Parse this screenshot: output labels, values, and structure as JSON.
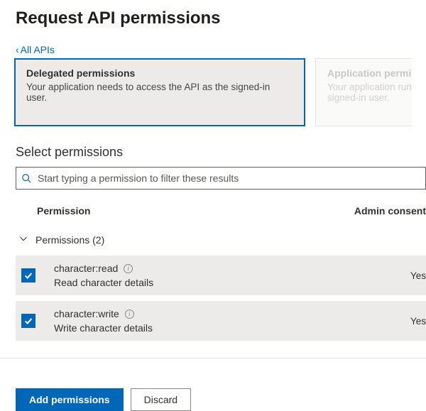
{
  "header": {
    "title": "Request API permissions"
  },
  "nav": {
    "back_label": "All APIs"
  },
  "permission_type_cards": {
    "delegated": {
      "title": "Delegated permissions",
      "subtitle": "Your application needs to access the API as the signed-in user."
    },
    "application": {
      "title": "Application permissions",
      "subtitle": "Your application runs as a background service without a signed-in user."
    }
  },
  "select_section": {
    "heading": "Select permissions",
    "search_placeholder": "Start typing a permission to filter these results"
  },
  "table": {
    "columns": {
      "permission": "Permission",
      "admin_consent": "Admin consent"
    },
    "group": {
      "label": "Permissions (2)",
      "expanded": true
    },
    "rows": [
      {
        "id": "character-read",
        "name": "character:read",
        "description": "Read character details",
        "admin_short": "Yes",
        "checked": true
      },
      {
        "id": "character-write",
        "name": "character:write",
        "description": "Write character details",
        "admin_short": "Yes",
        "checked": true
      }
    ]
  },
  "footer": {
    "primary": "Add permissions",
    "secondary": "Discard"
  }
}
